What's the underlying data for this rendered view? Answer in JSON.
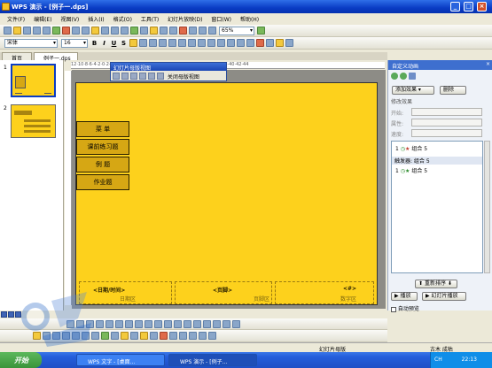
{
  "window": {
    "title": "WPS 演示 - [例子一.dps]"
  },
  "menu": [
    "文件(F)",
    "编辑(E)",
    "视图(V)",
    "插入(I)",
    "格式(O)",
    "工具(T)",
    "幻灯片放映(D)",
    "窗口(W)",
    "帮助(H)"
  ],
  "toolbar": {
    "zoom": "65%",
    "font": "宋体",
    "size": "16",
    "bold": "B",
    "italic": "I",
    "underline": "U",
    "shadow": "S"
  },
  "tabs": [
    "首页",
    "例子一.dps"
  ],
  "slides": [
    "1",
    "2"
  ],
  "float_toolbar": {
    "title": "幻灯片母版视图",
    "close_label": "关闭母版视图"
  },
  "slide": {
    "menu_buttons": [
      "菜  单",
      "课前练习题",
      "例  题",
      "作业题"
    ],
    "footers": [
      {
        "title": "<日期/时间>",
        "sub": "日期区"
      },
      {
        "title": "<页脚>",
        "sub": "页脚区"
      },
      {
        "title": "<#>",
        "sub": "数字区"
      }
    ]
  },
  "task_pane": {
    "title": "自定义动画",
    "add_effect": "添加效果",
    "remove": "删除",
    "modify_label": "修改效果",
    "start_label": "开始:",
    "property_label": "属性:",
    "speed_label": "速度:",
    "items": [
      {
        "num": "1",
        "name": "组合 5"
      },
      {
        "num": "1",
        "name": "组合 5"
      }
    ],
    "trigger_label": "触发器: 组合 5",
    "reorder": "重新排序",
    "play": "播放",
    "slideshow": "幻灯片播放",
    "autopreview": "自动预览"
  },
  "status": {
    "left": "幻灯片母版",
    "right": "古木 成枯"
  },
  "taskbar": {
    "start": "开始",
    "items": [
      "WPS 文字 - [桌面...",
      "WPS 演示 - [例子..."
    ],
    "time": "22:13",
    "lang": "CH"
  },
  "colors": {
    "slide_bg": "#fdd11c",
    "title_blue": "#0a3cc4",
    "button_fill": "#d6a714"
  }
}
